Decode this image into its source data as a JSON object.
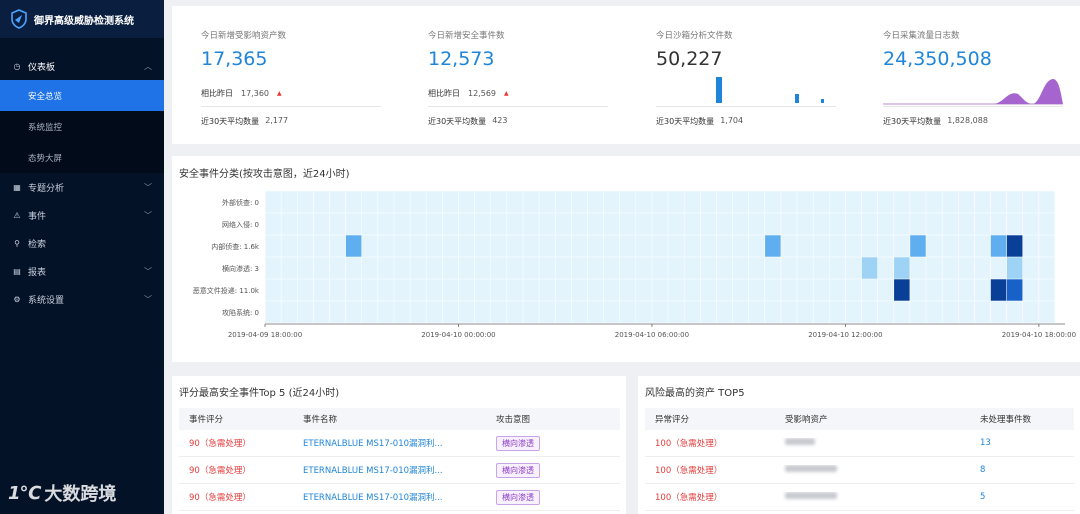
{
  "app": {
    "title": "御界高级威胁检测系统"
  },
  "sidebar": {
    "items": [
      {
        "label": "仪表板",
        "icon": "dashboard-icon",
        "open": true,
        "children": [
          {
            "label": "安全总览",
            "active": true
          },
          {
            "label": "系统监控"
          },
          {
            "label": "态势大屏"
          }
        ]
      },
      {
        "label": "专题分析",
        "icon": "grid-icon"
      },
      {
        "label": "事件",
        "icon": "warning-icon"
      },
      {
        "label": "检索",
        "icon": "search-icon"
      },
      {
        "label": "报表",
        "icon": "report-icon"
      },
      {
        "label": "系统设置",
        "icon": "gear-icon"
      }
    ]
  },
  "watermark": {
    "logo": "1℃",
    "text": "大数跨境"
  },
  "stats": [
    {
      "label": "今日新增受影响资产数",
      "value": "17,365",
      "compare_label": "相比昨日",
      "compare_value": "17,360",
      "avg_label": "近30天平均数量",
      "avg_value": "2,177"
    },
    {
      "label": "今日新增安全事件数",
      "value": "12,573",
      "compare_label": "相比昨日",
      "compare_value": "12,569",
      "avg_label": "近30天平均数量",
      "avg_value": "423"
    },
    {
      "label": "今日沙箱分析文件数",
      "value": "50,227",
      "avg_label": "近30天平均数量",
      "avg_value": "1,704"
    },
    {
      "label": "今日采集流量日志数",
      "value": "24,350,508",
      "avg_label": "近30天平均数量",
      "avg_value": "1,828,088"
    }
  ],
  "colors": {
    "accent": "#1f85d8",
    "sidebar_bg": "#041228",
    "active": "#1f73e6",
    "heat_bg": "#e3f4fd",
    "heat_low": "#9fd3f5",
    "heat_mid": "#5eaef0",
    "heat_high": "#1761c8",
    "heat_max": "#0a3f98"
  },
  "heatmap": {
    "title": "安全事件分类(按攻击意图，近24小时)",
    "rows": [
      "外部侦查: 0",
      "网络入侵: 0",
      "内部侦查: 1.6k",
      "横向渗透: 3",
      "恶意文件投递: 11.0k",
      "攻陷系统: 0"
    ],
    "x_ticks": [
      "2019-04-09 18:00:00",
      "2019-04-10 00:00:00",
      "2019-04-10 06:00:00",
      "2019-04-10 12:00:00",
      "2019-04-10 18:00:00"
    ],
    "cols": 49,
    "cells": [
      {
        "row": 2,
        "col": 5,
        "level": 2
      },
      {
        "row": 2,
        "col": 31,
        "level": 2
      },
      {
        "row": 2,
        "col": 40,
        "level": 2
      },
      {
        "row": 2,
        "col": 45,
        "level": 2
      },
      {
        "row": 2,
        "col": 46,
        "level": 4
      },
      {
        "row": 3,
        "col": 37,
        "level": 1
      },
      {
        "row": 3,
        "col": 39,
        "level": 1
      },
      {
        "row": 3,
        "col": 46,
        "level": 1
      },
      {
        "row": 4,
        "col": 39,
        "level": 4
      },
      {
        "row": 4,
        "col": 45,
        "level": 4
      },
      {
        "row": 4,
        "col": 46,
        "level": 3
      }
    ]
  },
  "top_events": {
    "title": "评分最高安全事件Top 5 (近24小时)",
    "headers": [
      "事件评分",
      "事件名称",
      "攻击意图"
    ],
    "rows": [
      {
        "score": "90（急需处理）",
        "name": "ETERNALBLUE MS17-010漏洞利...",
        "intent": "横向渗透"
      },
      {
        "score": "90（急需处理）",
        "name": "ETERNALBLUE MS17-010漏洞利...",
        "intent": "横向渗透"
      },
      {
        "score": "90（急需处理）",
        "name": "ETERNALBLUE MS17-010漏洞利...",
        "intent": "横向渗透"
      }
    ]
  },
  "top_assets": {
    "title": "风险最高的资产 TOP5",
    "headers": [
      "异常评分",
      "受影响资产",
      "未处理事件数"
    ],
    "rows": [
      {
        "score": "100（急需处理）",
        "count": "13"
      },
      {
        "score": "100（急需处理）",
        "count": "8"
      },
      {
        "score": "100（急需处理）",
        "count": "5"
      }
    ]
  }
}
